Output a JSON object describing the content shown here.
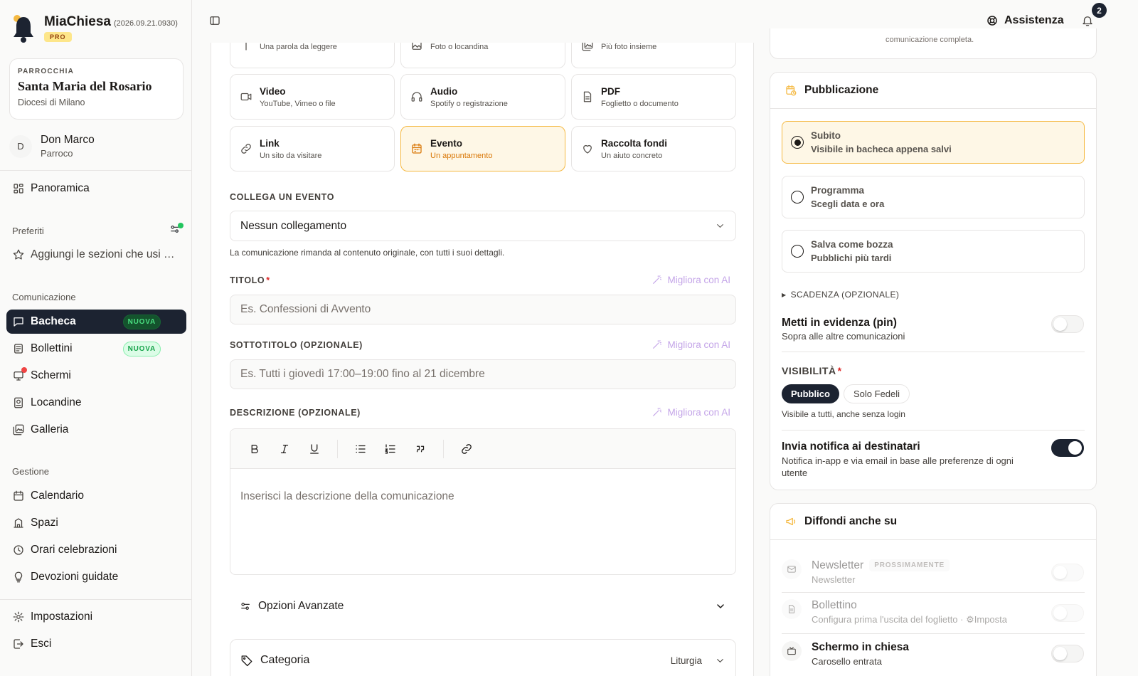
{
  "app": {
    "name": "MiaChiesa",
    "version": "(2026.09.21.0930)",
    "plan": "PRO"
  },
  "parish": {
    "label": "PARROCCHIA",
    "name": "Santa Maria del Rosario",
    "diocese": "Diocesi di Milano"
  },
  "user": {
    "initial": "D",
    "name": "Don Marco",
    "role": "Parroco"
  },
  "nav": {
    "overview": "Panoramica",
    "favorites_title": "Preferiti",
    "favorites_add": "Aggiungi le sezioni che usi …",
    "communication_title": "Comunicazione",
    "board": "Bacheca",
    "board_badge": "NUOVA",
    "bulletins": "Bollettini",
    "bulletins_badge": "NUOVA",
    "screens": "Schermi",
    "posters": "Locandine",
    "gallery": "Galleria",
    "management_title": "Gestione",
    "calendar": "Calendario",
    "spaces": "Spazi",
    "mass_times": "Orari celebrazioni",
    "devotions": "Devozioni guidate",
    "settings": "Impostazioni",
    "logout": "Esci"
  },
  "topbar": {
    "help": "Assistenza",
    "notifications_count": "2"
  },
  "content_types": [
    {
      "title": "",
      "desc": "Una parola da leggere",
      "icon": "text-icon"
    },
    {
      "title": "",
      "desc": "Foto o locandina",
      "icon": "image-icon"
    },
    {
      "title": "",
      "desc": "Più foto insieme",
      "icon": "images-icon"
    },
    {
      "title": "Video",
      "desc": "YouTube, Vimeo o file",
      "icon": "video-icon"
    },
    {
      "title": "Audio",
      "desc": "Spotify o registrazione",
      "icon": "headphones-icon"
    },
    {
      "title": "PDF",
      "desc": "Foglietto o documento",
      "icon": "file-icon"
    },
    {
      "title": "Link",
      "desc": "Un sito da visitare",
      "icon": "link-icon"
    },
    {
      "title": "Evento",
      "desc": "Un appuntamento",
      "icon": "calendar-icon",
      "selected": true
    },
    {
      "title": "Raccolta fondi",
      "desc": "Un aiuto concreto",
      "icon": "heart-icon"
    }
  ],
  "form": {
    "link_event_label": "COLLEGA UN EVENTO",
    "link_event_value": "Nessun collegamento",
    "link_event_hint": "La comunicazione rimanda al contenuto originale, con tutti i suoi dettagli.",
    "title_label": "TITOLO",
    "required_mark": "*",
    "title_placeholder": "Es. Confessioni di Avvento",
    "subtitle_label": "SOTTOTITOLO (OPZIONALE)",
    "subtitle_placeholder": "Es. Tutti i giovedì 17:00–19:00 fino al 21 dicembre",
    "description_label": "DESCRIZIONE (OPZIONALE)",
    "description_placeholder": "Inserisci la descrizione della comunicazione",
    "ai_improve": "Migliora con AI",
    "advanced_options": "Opzioni Avanzate",
    "category_label": "Categoria",
    "category_value": "Liturgia"
  },
  "right_prev_text": "comunicazione completa.",
  "publication": {
    "title": "Pubblicazione",
    "options": [
      {
        "title": "Subito",
        "desc": "Visibile in bacheca appena salvi",
        "selected": true
      },
      {
        "title": "Programma",
        "desc": "Scegli data e ora",
        "selected": false
      },
      {
        "title": "Salva come bozza",
        "desc": "Pubblichi più tardi",
        "selected": false
      }
    ],
    "deadline": "SCADENZA (OPZIONALE)",
    "pin_title": "Metti in evidenza (pin)",
    "pin_desc": "Sopra alle altre comunicazioni",
    "pin_on": false,
    "visibility_label": "VISIBILITÀ",
    "visibility_public": "Pubblico",
    "visibility_faithful": "Solo Fedeli",
    "visibility_desc": "Visibile a tutti, anche senza login",
    "notify_title": "Invia notifica ai destinatari",
    "notify_desc": "Notifica in-app e via email in base alle preferenze di ogni utente",
    "notify_on": true
  },
  "spread": {
    "title": "Diffondi anche su",
    "channels": [
      {
        "name": "Newsletter",
        "badge": "PROSSIMAMENTE",
        "desc": "Newsletter",
        "icon": "mail-icon"
      },
      {
        "name": "Bollettino",
        "desc": "Configura prima l'uscita del foglietto ·",
        "action": "Imposta",
        "icon": "doc-icon"
      },
      {
        "name": "Schermo in chiesa",
        "desc": "Carosello entrata",
        "icon": "tv-icon"
      }
    ]
  }
}
